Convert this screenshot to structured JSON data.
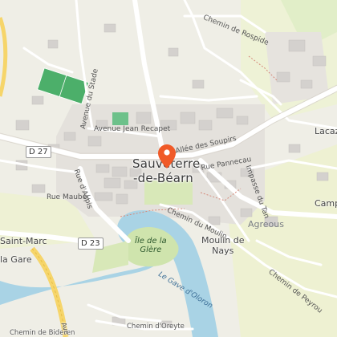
{
  "map": {
    "town_lines": [
      "Sauveterre",
      "-de-Béarn"
    ],
    "places": {
      "saint_marc": "Saint-Marc",
      "lacaze": "Lacaze",
      "campa": "Campa",
      "agreous": "Agreous",
      "moulin": [
        "Moulin de",
        "Nays"
      ],
      "ile": [
        "Île de la",
        "Glère"
      ]
    },
    "roads": {
      "chemin_rospide": "Chemin de Rospide",
      "avenue_stade": "Avenue du Stade",
      "avenue_recapet": "Avenue Jean Recapet",
      "allee_soupirs": "Allée des Soupirs",
      "rue_pannecau": "Rue Pannecau",
      "rue_aspis": "Rue d'Aspis",
      "rue_maubec": "Rue Maubec",
      "chemin_moulin": "Chemin du Moulin",
      "impasse_tan": "Impasse du Tan",
      "la_gare": "la Gare",
      "chemin_peyrou": "Chemin de Peyrou",
      "chemin_bideren": "Chemin de Bideren",
      "chemin_oreyte": "Chemin d'Oreyte",
      "avenue_cut": "Ave"
    },
    "river": "Le Gave d'Oloron",
    "shields": {
      "d27": "D 27",
      "d23": "D 23"
    },
    "marker": {
      "name": "location-marker",
      "color": "#f05a28"
    },
    "colors": {
      "land": "#efeee6",
      "water": "#a9d3e5",
      "park": "#d8e8b8",
      "sport_field": "#4caf6a",
      "building": "#d4d1ce",
      "road": "#ffffff",
      "major_road": "#f6d56a"
    }
  }
}
